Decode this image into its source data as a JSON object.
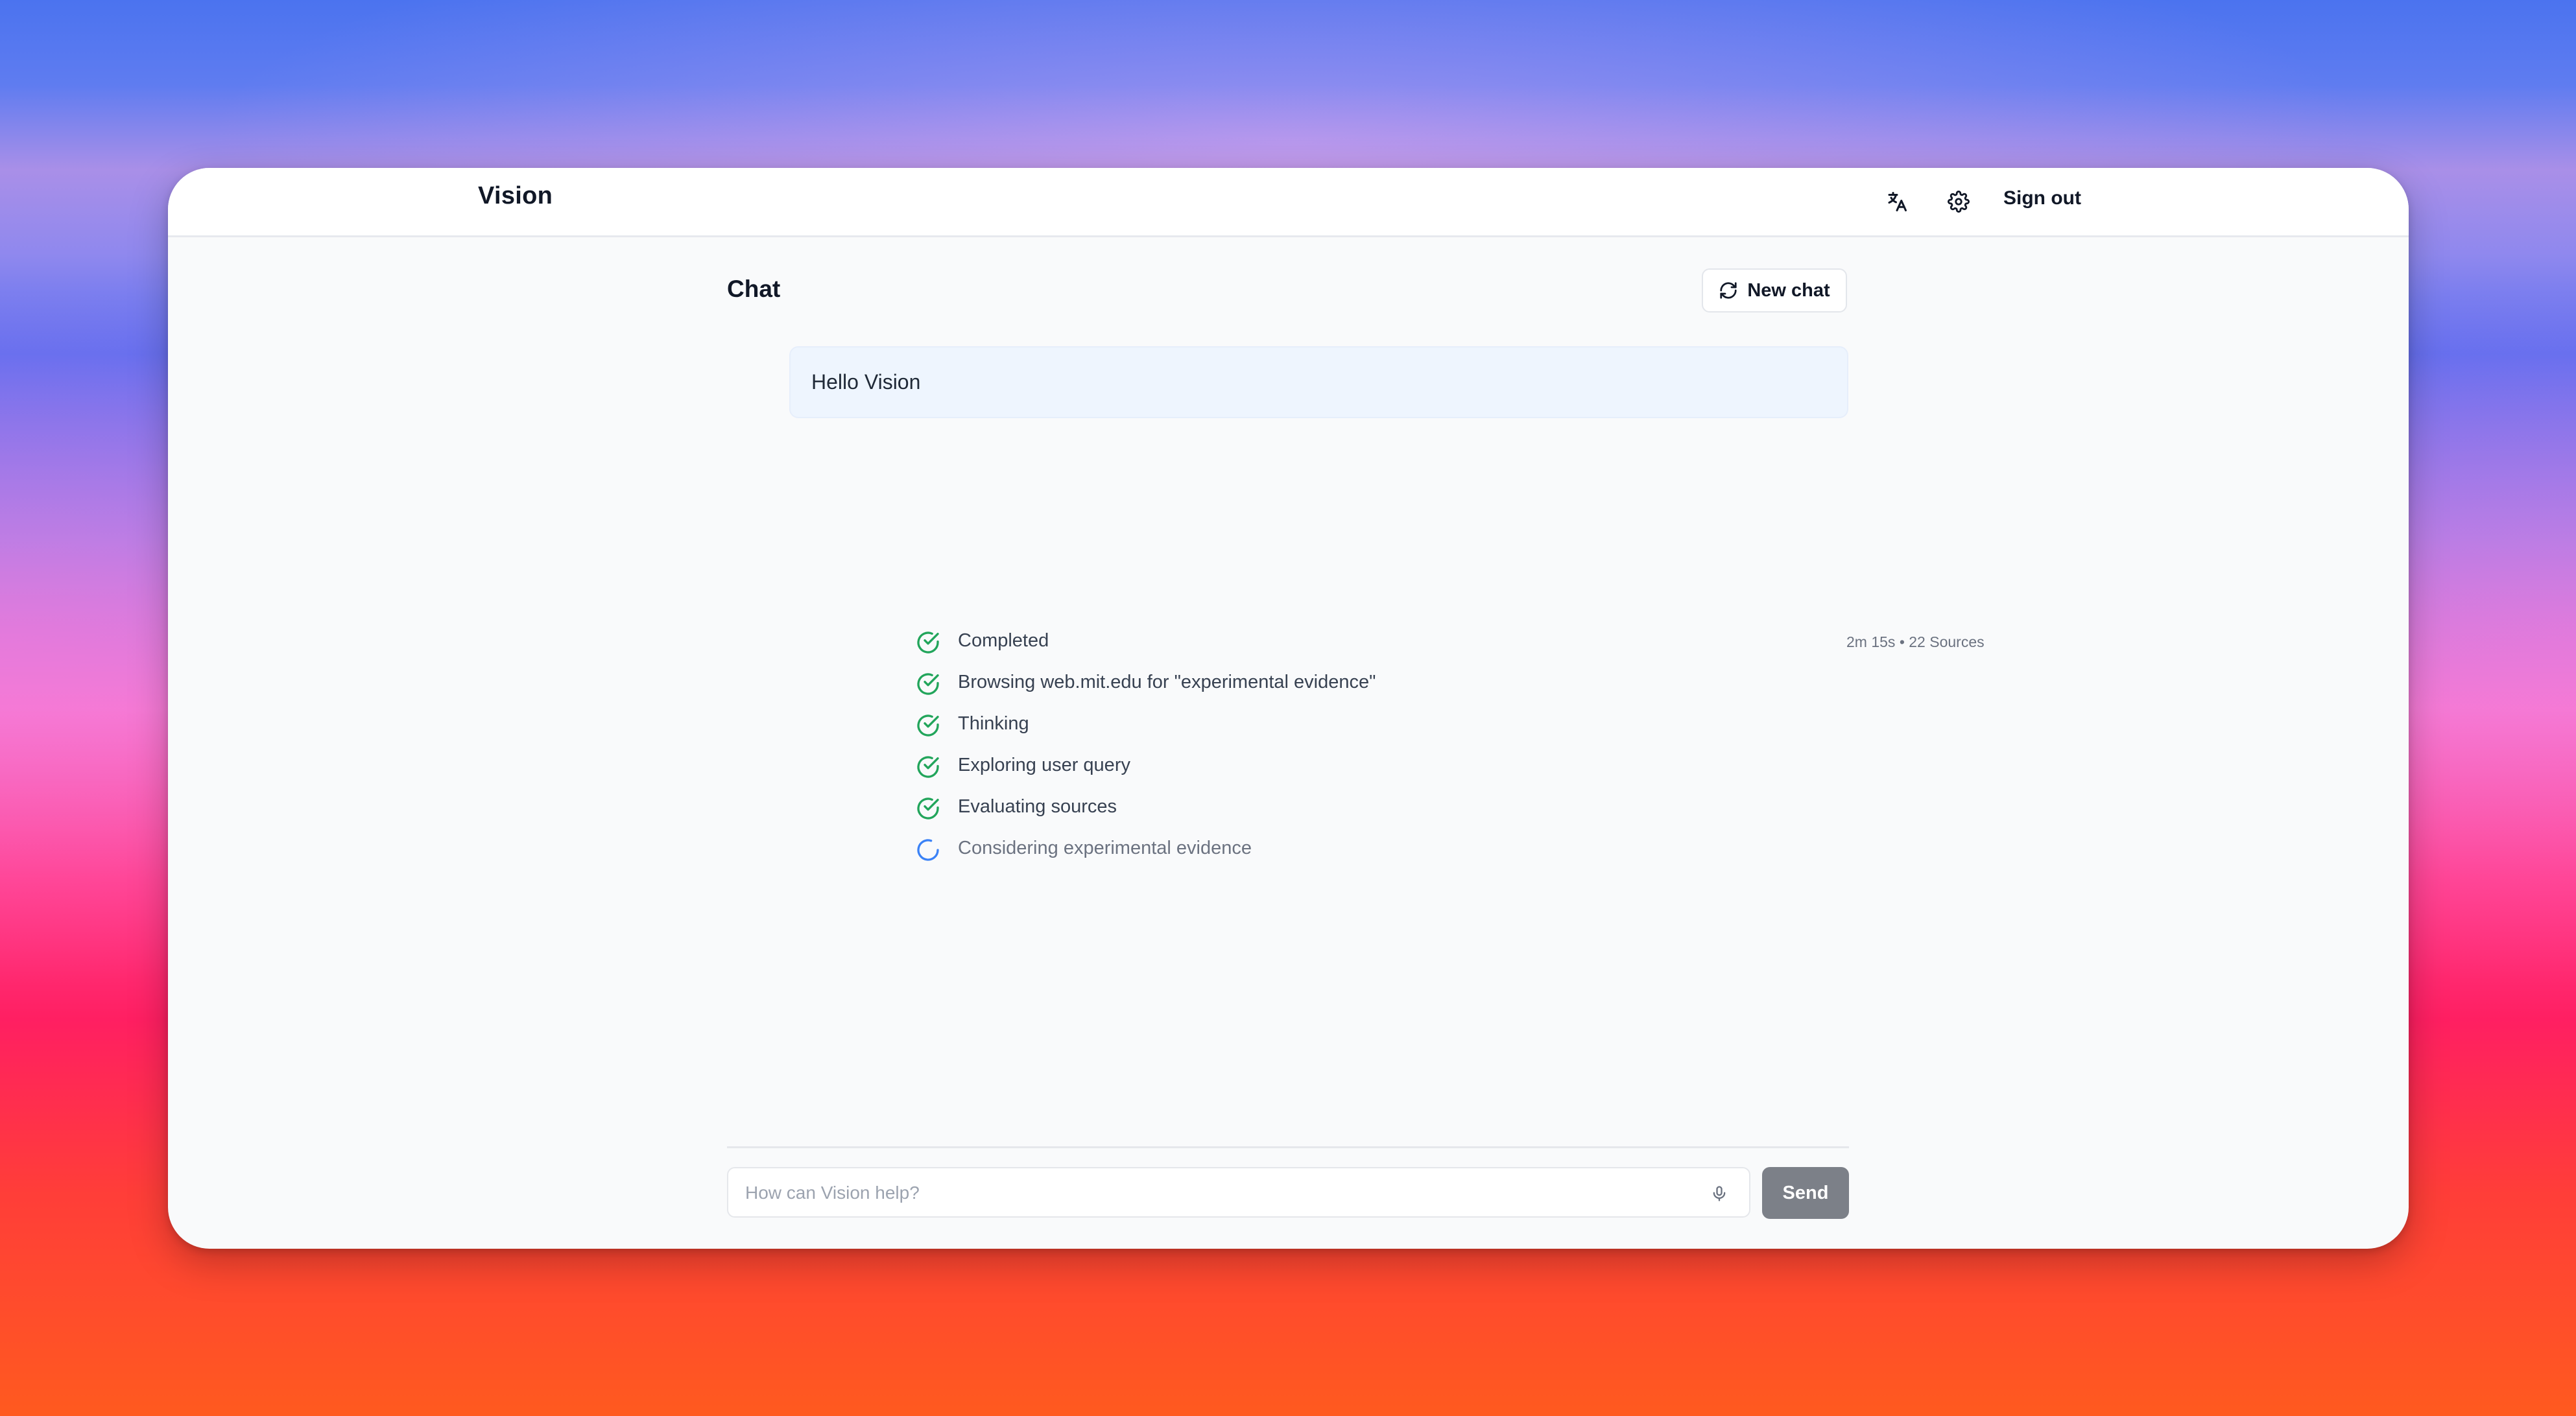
{
  "app": {
    "brand": "Vision",
    "sign_out_label": "Sign out",
    "icons": {
      "translate": "translate-icon",
      "settings": "gear-icon"
    }
  },
  "chat": {
    "title": "Chat",
    "new_chat_label": "New chat",
    "new_chat_icon": "refresh-icon",
    "user_message": "Hello Vision"
  },
  "progress": {
    "meta": "2m 15s • 22 Sources",
    "steps": [
      {
        "label": "Completed",
        "status": "done"
      },
      {
        "label": "Browsing web.mit.edu for \"experimental evidence\"",
        "status": "done"
      },
      {
        "label": "Thinking",
        "status": "done"
      },
      {
        "label": "Exploring user query",
        "status": "done"
      },
      {
        "label": "Evaluating sources",
        "status": "done"
      },
      {
        "label": "Considering experimental evidence",
        "status": "in-progress"
      }
    ]
  },
  "composer": {
    "placeholder": "How can Vision help?",
    "value": "",
    "mic_icon": "microphone-icon",
    "send_label": "Send"
  },
  "colors": {
    "done": "#22a55b",
    "in_progress": "#3b82f6",
    "send_button": "#7c8088",
    "user_bubble": "#eef5fe"
  }
}
